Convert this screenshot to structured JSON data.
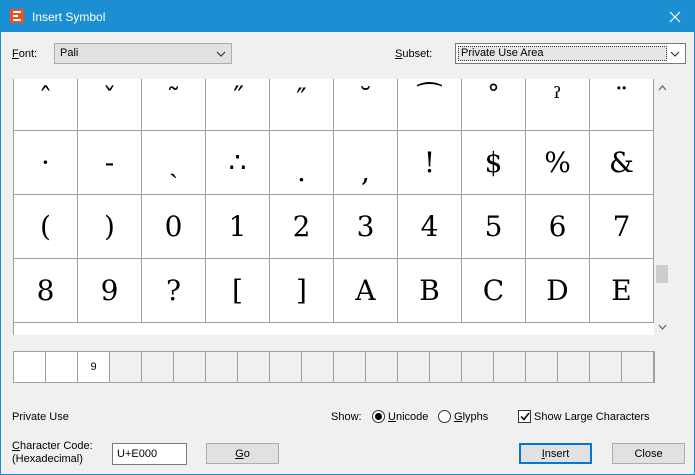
{
  "window": {
    "title": "Insert Symbol",
    "close_glyph": "✕"
  },
  "font": {
    "label_accel": "F",
    "label_rest": "ont:",
    "value": "Pali"
  },
  "subset": {
    "label_accel": "S",
    "label_rest": "ubset:",
    "value": "Private Use Area"
  },
  "symbols": [
    [
      "ˆ",
      "ˇ",
      "˜",
      "˝",
      "″",
      "˘",
      "⁀",
      "˚",
      "ˀ",
      "¨"
    ],
    [
      "·",
      "-",
      "ˏ",
      "∴",
      ".",
      ",",
      "!",
      "$",
      "%",
      "&"
    ],
    [
      "(",
      ")",
      "0",
      "1",
      "2",
      "3",
      "4",
      "5",
      "6",
      "7"
    ],
    [
      "8",
      "9",
      "?",
      "[",
      "]",
      "A",
      "B",
      "C",
      "D",
      "E"
    ]
  ],
  "recent": [
    "",
    "",
    "9",
    "",
    "",
    "",
    "",
    "",
    "",
    "",
    "",
    "",
    "",
    "",
    "",
    "",
    "",
    "",
    "",
    ""
  ],
  "status": {
    "char_name": "Private Use"
  },
  "show": {
    "label": "Show:",
    "unicode_accel": "U",
    "unicode_rest": "nicode",
    "glyphs_accel": "G",
    "glyphs_rest": "lyphs",
    "large_label": "Show Large Characters"
  },
  "code": {
    "label1_accel": "C",
    "label1_rest": "haracter Code:",
    "label2": "(Hexadecimal)",
    "value": "U+E000"
  },
  "buttons": {
    "go_accel": "G",
    "go_rest": "o",
    "insert_accel": "I",
    "insert_rest": "nsert",
    "close": "Close"
  },
  "colors": {
    "titlebar": "#1b8fd1",
    "default_button_border": "#0078d7"
  }
}
